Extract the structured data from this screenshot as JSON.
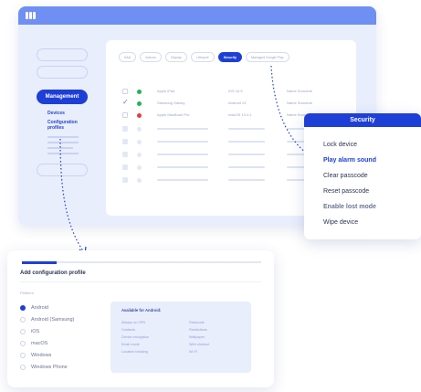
{
  "sidebar": {
    "management_label": "Management",
    "devices_label": "Devices",
    "config_label_line1": "Configuration",
    "config_label_line2": "profiles"
  },
  "tabs": [
    {
      "label": "AAA",
      "active": false
    },
    {
      "label": "Actions",
      "active": false
    },
    {
      "label": "Display",
      "active": false
    },
    {
      "label": "Lifecycle",
      "active": false
    },
    {
      "label": "Security",
      "active": true
    },
    {
      "label": "Managed Google Play",
      "active": false
    }
  ],
  "devices": [
    {
      "name": "Apple iPad",
      "os": "iOS 16.5",
      "user": "Name Surname",
      "status_color": "#22b455",
      "checked": false
    },
    {
      "name": "Samsung Galaxy",
      "os": "Android 13",
      "user": "Name Surname",
      "status_color": "#22b455",
      "checked": true
    },
    {
      "name": "Apple MacBook Pro",
      "os": "macOS 13.4.1",
      "user": "Name Surname",
      "status_color": "#e04040",
      "checked": false
    }
  ],
  "security_menu": {
    "title": "Security",
    "items": [
      "Lock device",
      "Play alarm sound",
      "Clear passcode",
      "Reset passcode",
      "Enable lost mode",
      "Wipe device"
    ],
    "highlighted_index": 1
  },
  "config": {
    "title": "Add configuration profile",
    "platform_label": "Platform",
    "platforms": [
      "Android",
      "Android (Samsung)",
      "iOS",
      "macOS",
      "Windows",
      "Windows Phone"
    ],
    "selected_platform_index": 0,
    "available_title": "Available for Android:",
    "features_left": [
      "Always on VPN",
      "Contacts",
      "Device encryption",
      "Kiosk mode",
      "Location tracking"
    ],
    "features_right": [
      "Passcode",
      "Restrictions",
      "Wallpaper",
      "Web shortcut",
      "Wi-Fi"
    ]
  },
  "colors": {
    "accent": "#1e3fd6",
    "titlebar": "#6f8ff3",
    "status_ok": "#22b455",
    "status_error": "#e04040"
  }
}
